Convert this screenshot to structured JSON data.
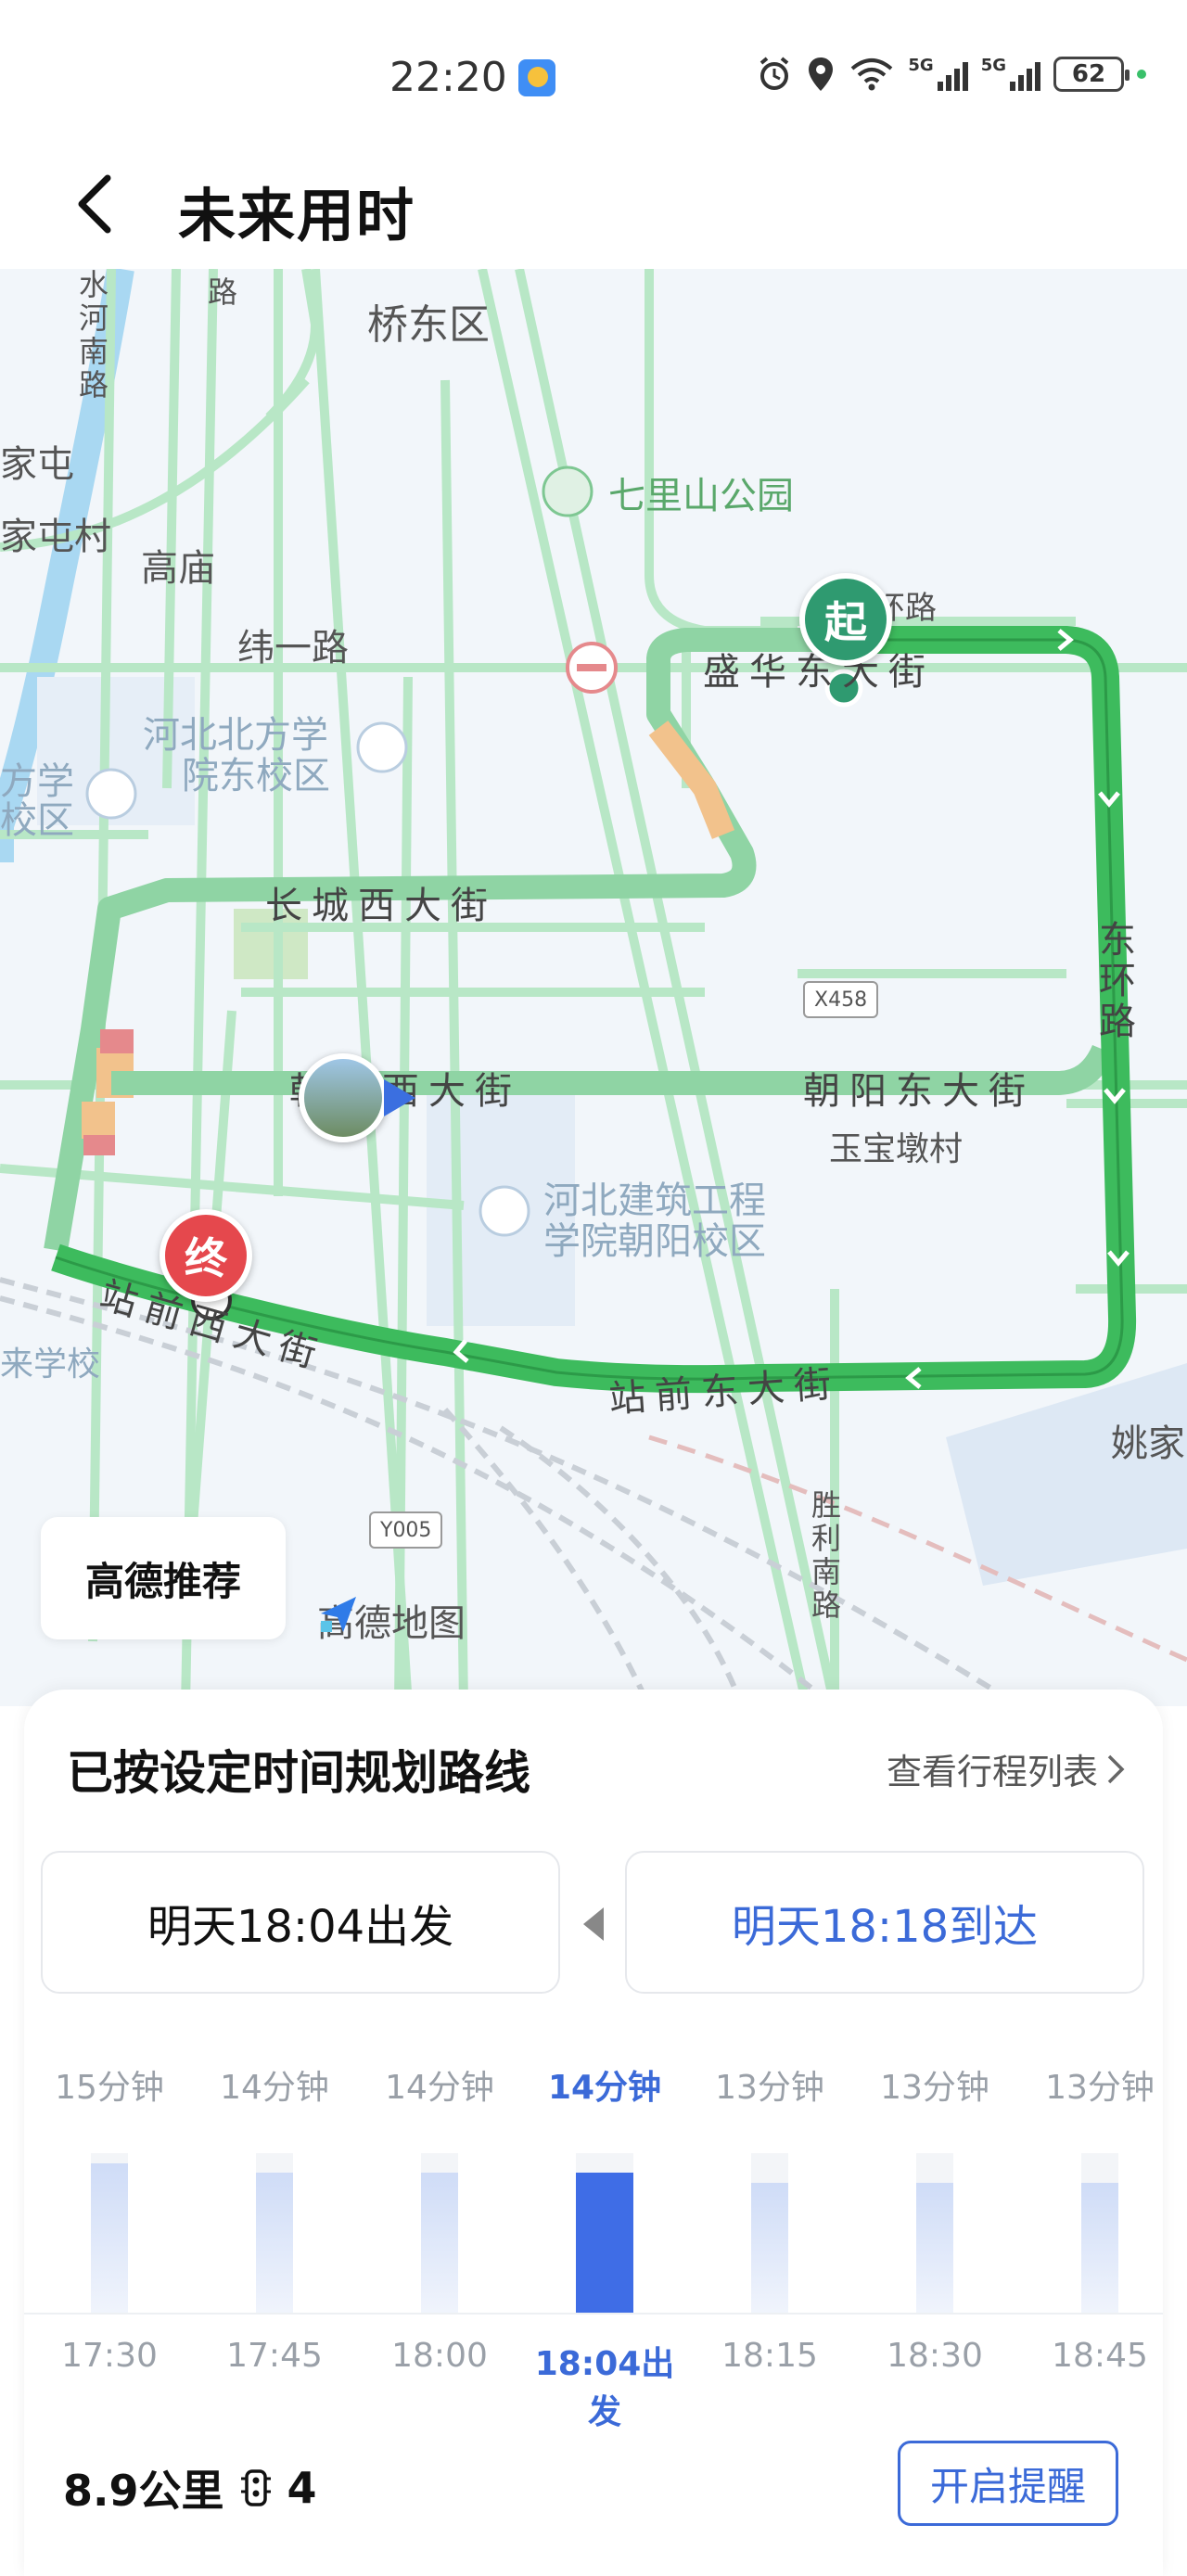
{
  "status_bar": {
    "time": "22:20",
    "battery": "62",
    "signal_1": "5G",
    "signal_2": "5G"
  },
  "header": {
    "title": "未来用时"
  },
  "map": {
    "labels": {
      "qiaodong": "桥东区",
      "qilishan": "七里山公园",
      "weiyi": "纬一路",
      "gaomiao": "高庙",
      "shenghua": "盛华东大街",
      "hebei_north": "河北北方学",
      "hebei_north_2": "院东校区",
      "fangxue_1": "方学",
      "fangxue_2": "校区",
      "changcheng": "长城西大街",
      "chaoyang_west": "朝阳西大街",
      "chaoyang_east": "朝阳东大街",
      "dong_huan": "东环路",
      "dong_huan_top": "东环路",
      "yubaodun": "玉宝墩村",
      "hebei_arch_1": "河北建筑工程",
      "hebei_arch_2": "学院朝阳校区",
      "zhanqian_west": "站前西大街",
      "zhanqian_east": "站前东大街",
      "laixue": "来学校",
      "yaojia": "姚家",
      "shengli": "胜利南路",
      "shuihe": "水河南路",
      "jiatun": "家屯",
      "jiatuncun": "家屯村",
      "road_top": "路"
    },
    "road_codes": {
      "x458": "X458",
      "y005": "Y005"
    },
    "start_marker": "起",
    "end_marker": "终",
    "recommend_button": "高德推荐",
    "brand": "高德地图",
    "colors": {
      "route_green": "#3dbb5d",
      "route_light": "#8fd4a4",
      "route_slow": "#f2c28c",
      "route_jam": "#e5898c"
    }
  },
  "panel": {
    "title": "已按设定时间规划路线",
    "schedule_link": "查看行程列表",
    "depart": "明天18:04出发",
    "arrive": "明天18:18到达",
    "slots": [
      {
        "duration": "15分钟",
        "time": "17:30",
        "minutes": 15,
        "active": false
      },
      {
        "duration": "14分钟",
        "time": "17:45",
        "minutes": 14,
        "active": false
      },
      {
        "duration": "14分钟",
        "time": "18:00",
        "minutes": 14,
        "active": false
      },
      {
        "duration": "14分钟",
        "time": "18:04出发",
        "minutes": 14,
        "active": true
      },
      {
        "duration": "13分钟",
        "time": "18:15",
        "minutes": 13,
        "active": false
      },
      {
        "duration": "13分钟",
        "time": "18:30",
        "minutes": 13,
        "active": false
      },
      {
        "duration": "13分钟",
        "time": "18:45",
        "minutes": 13,
        "active": false
      }
    ],
    "distance": "8.9公里",
    "traffic_lights": "4",
    "remind_button": "开启提醒",
    "accent_color": "#3b6ad8"
  }
}
